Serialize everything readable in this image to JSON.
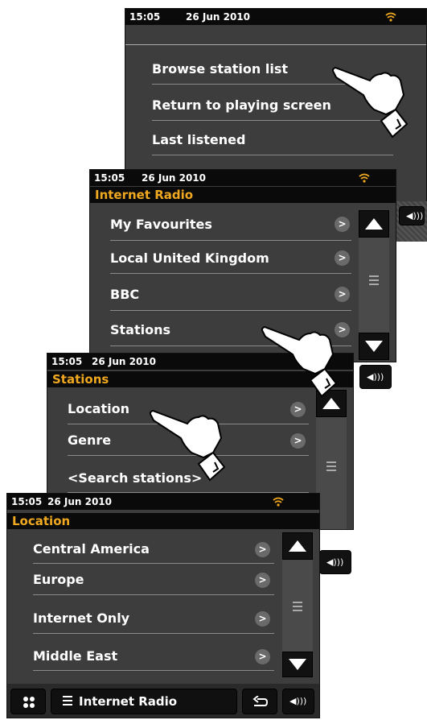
{
  "screens": [
    {
      "time": "15:05",
      "date": "26 Jun 2010",
      "items": [
        "Browse station list",
        "Return to playing screen",
        "Last listened"
      ]
    },
    {
      "time": "15:05",
      "date": "26 Jun 2010",
      "title": "Internet Radio",
      "items": [
        "My Favourites",
        "Local United Kingdom",
        "BBC",
        "Stations"
      ]
    },
    {
      "time": "15:05",
      "date": "26 Jun 2010",
      "title": "Stations",
      "items": [
        "Location",
        "Genre",
        "<Search stations>"
      ]
    },
    {
      "time": "15:05",
      "date": "26 Jun 2010",
      "title": "Location",
      "items": [
        "Central America",
        "Europe",
        "Internet Only",
        "Middle East"
      ],
      "bottom_label": "Internet Radio"
    }
  ],
  "icons": {
    "chevron": ">",
    "scroll_menu": "menu-lines-icon",
    "wifi": "wifi-icon",
    "volume": "volume-icon",
    "back": "back-arrow-icon",
    "home": "home-grid-icon"
  },
  "colors": {
    "accent": "#f0a820",
    "screen_bg": "#3d3d3d",
    "bar_bg": "#0a0a0a",
    "text": "#ffffff"
  }
}
